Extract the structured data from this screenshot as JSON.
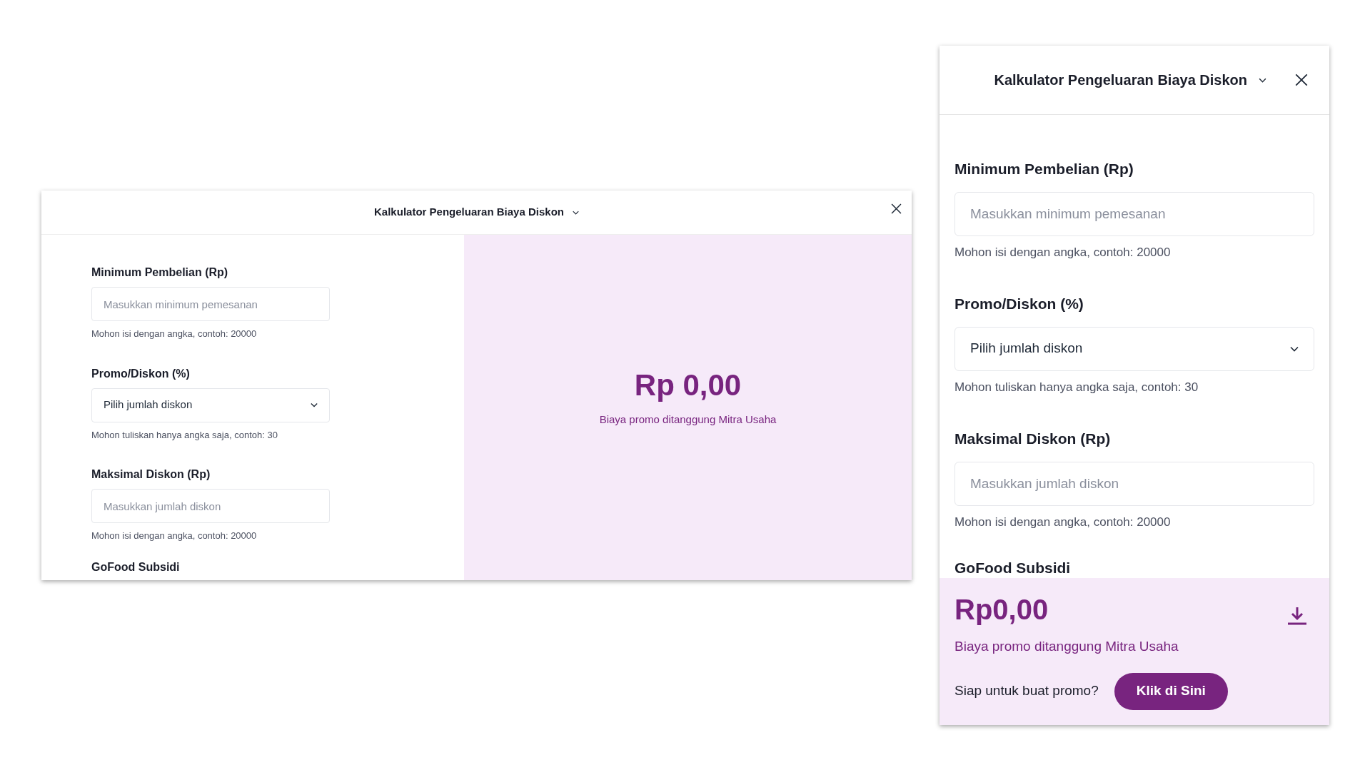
{
  "panels": [
    {
      "kind": "wide",
      "title": "Kalkulator Pengeluaran Biaya Diskon",
      "fields": [
        {
          "kind": "input",
          "label": "Minimum Pembelian (Rp)",
          "placeholder": "Masukkan minimum pemesanan",
          "hint": "Mohon isi dengan angka, contoh: 20000"
        },
        {
          "kind": "select",
          "label": "Promo/Diskon (%)",
          "value": "Pilih jumlah diskon",
          "hint": "Mohon tuliskan hanya angka saja, contoh: 30"
        },
        {
          "kind": "input",
          "label": "Maksimal Diskon (Rp)",
          "placeholder": "Masukkan jumlah diskon",
          "hint": "Mohon isi dengan angka, contoh: 20000"
        }
      ],
      "next_section": "GoFood Subsidi",
      "result": {
        "amount": "Rp 0,00",
        "caption": "Biaya promo ditanggung Mitra Usaha"
      }
    },
    {
      "kind": "narrow",
      "title": "Kalkulator Pengeluaran Biaya Diskon",
      "fields": [
        {
          "kind": "input",
          "label": "Minimum Pembelian (Rp)",
          "placeholder": "Masukkan minimum pemesanan",
          "hint": "Mohon isi dengan angka, contoh: 20000"
        },
        {
          "kind": "select",
          "label": "Promo/Diskon (%)",
          "value": "Pilih jumlah diskon",
          "hint": "Mohon tuliskan hanya angka saja, contoh: 30"
        },
        {
          "kind": "input",
          "label": "Maksimal Diskon (Rp)",
          "placeholder": "Masukkan jumlah diskon",
          "hint": "Mohon isi dengan angka, contoh: 20000"
        }
      ],
      "next_section": "GoFood Subsidi",
      "result": {
        "amount": "Rp0,00",
        "caption": "Biaya promo ditanggung Mitra Usaha",
        "prompt": "Siap untuk buat promo?",
        "button": "Klik di Sini"
      }
    }
  ]
}
